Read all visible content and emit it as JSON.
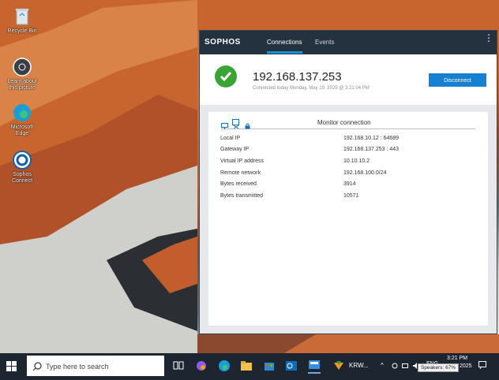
{
  "desktop": {
    "icons": [
      {
        "label": "Recycle Bin",
        "icon": "recycle-bin-icon"
      },
      {
        "label": "Learn about this picture",
        "icon": "camera-icon"
      },
      {
        "label": "Microsoft Edge",
        "icon": "edge-icon"
      },
      {
        "label": "Sophos Connect",
        "icon": "sophos-connect-icon"
      }
    ]
  },
  "sophos": {
    "brand": "SOPHOS",
    "tabs": [
      {
        "label": "Connections",
        "active": true
      },
      {
        "label": "Events",
        "active": false
      }
    ],
    "menu_icon": "kebab-menu-icon",
    "status": {
      "ip": "192.168.137.253",
      "subtitle": "Connected today Monday, May 19, 2025 @ 3:21:04 PM",
      "disconnect_label": "Disconnect",
      "status_color": "#3aa535"
    },
    "panel": {
      "title": "Monitor connection",
      "toolbar_icons": [
        "monitor-icon",
        "shuffle-icon",
        "lock-icon"
      ],
      "rows": [
        {
          "key": "Local IP",
          "value": "192.168.10.12 : 64689"
        },
        {
          "key": "Gateway IP",
          "value": "192.168.137.253 : 443"
        },
        {
          "key": "Virtual IP address",
          "value": "10.10.10.2"
        },
        {
          "key": "Remote network",
          "value": "192.168.100.0/24"
        },
        {
          "key": "Bytes received",
          "value": "3914"
        },
        {
          "key": "Bytes transmitted",
          "value": "10571"
        }
      ]
    },
    "accent_color": "#1680d2"
  },
  "taskbar": {
    "search_placeholder": "Type here to search",
    "app_label": "KRW...",
    "language": "ENG",
    "time": "3:21 PM",
    "date": "2025",
    "tooltip": "Speakers: 67%"
  }
}
